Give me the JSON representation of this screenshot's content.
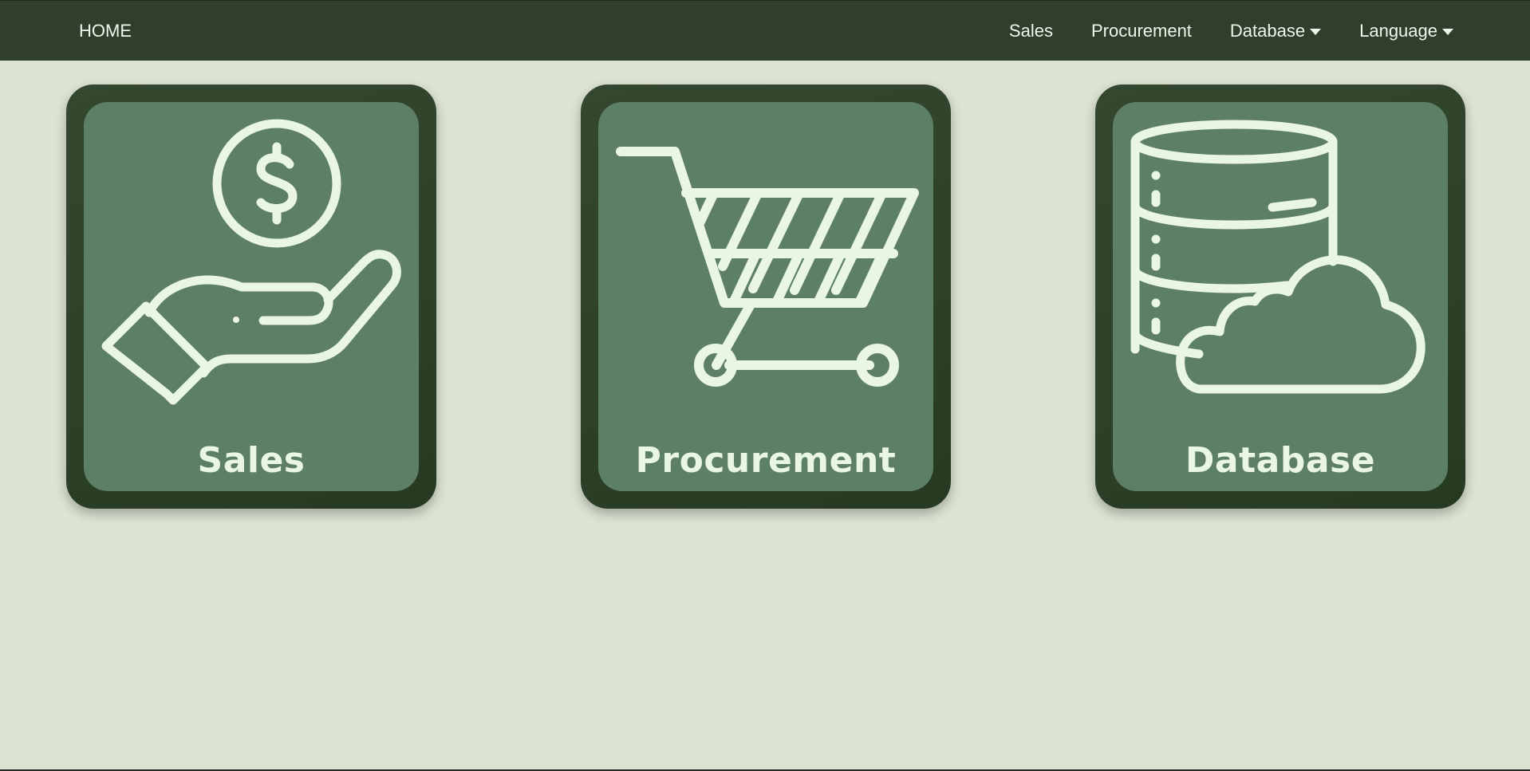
{
  "navbar": {
    "home_label": "HOME",
    "links": [
      {
        "label": "Sales",
        "has_dropdown": false
      },
      {
        "label": "Procurement",
        "has_dropdown": false
      },
      {
        "label": "Database",
        "has_dropdown": true
      },
      {
        "label": "Language",
        "has_dropdown": true
      }
    ]
  },
  "cards": [
    {
      "title": "Sales",
      "icon": "hand-coin-icon"
    },
    {
      "title": "Procurement",
      "icon": "shopping-cart-icon"
    },
    {
      "title": "Database",
      "icon": "database-cloud-icon"
    }
  ],
  "colors": {
    "background": "#dce3d2",
    "navbar": "#2f3f2c",
    "card_outer": "#2e4129",
    "card_inner": "#5d7f64",
    "icon_stroke": "#eaf6e4"
  }
}
